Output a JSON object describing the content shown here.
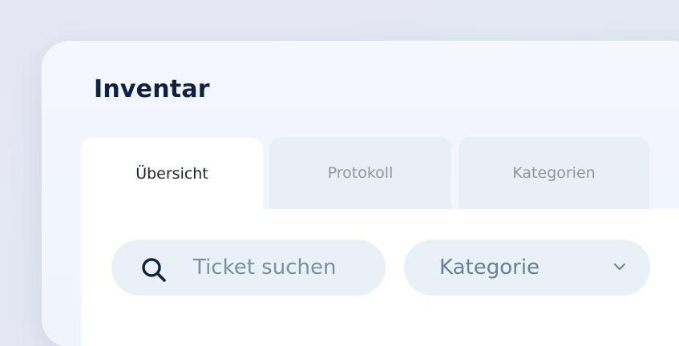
{
  "header": {
    "title": "Inventar"
  },
  "tabs": [
    {
      "label": "Übersicht",
      "active": true
    },
    {
      "label": "Protokoll",
      "active": false
    },
    {
      "label": "Kategorien",
      "active": false
    }
  ],
  "filters": {
    "search": {
      "placeholder": "Ticket suchen",
      "icon": "search-icon"
    },
    "category": {
      "selected": "Kategorie",
      "icon": "chevron-down-icon"
    }
  },
  "colors": {
    "title": "#0e2240",
    "active_tab_bg": "#ffffff",
    "inactive_tab_bg": "#e9eff6",
    "field_bg": "#e8f1f6"
  }
}
